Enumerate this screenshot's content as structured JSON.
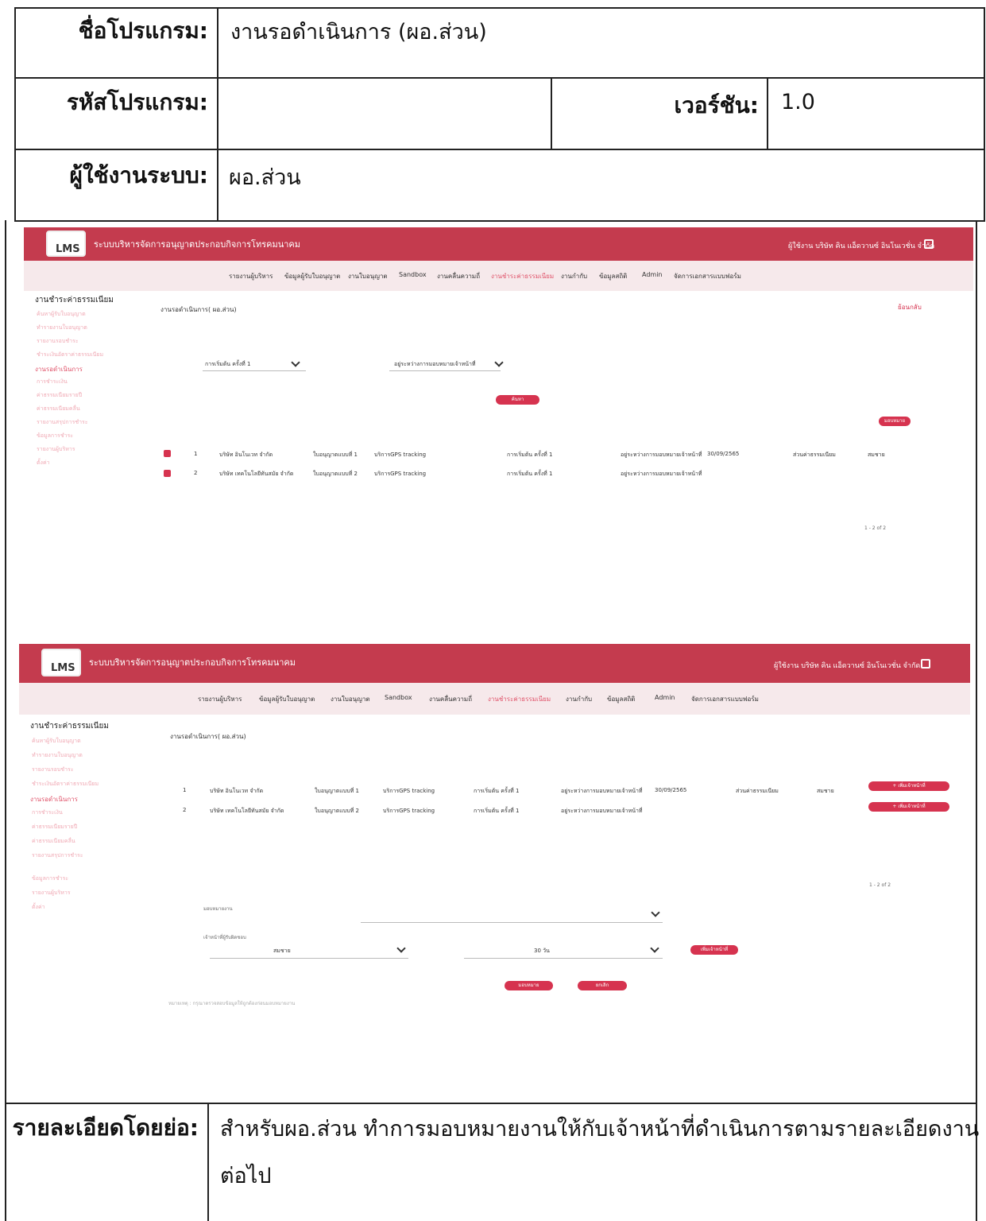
{
  "form": {
    "program_name_label": "ชื่อโปรแกรม:",
    "program_name_value": "งานรอดำเนินการ (ผอ.ส่วน)",
    "program_code_label": "รหัสโปรแกรม:",
    "program_code_value": "",
    "version_label": "เวอร์ชัน:",
    "version_value": "1.0",
    "user_label": "ผู้ใช้งานระบบ:",
    "user_value": "ผอ.ส่วน",
    "summary_label": "รายละเอียดโดยย่อ:",
    "summary_line1": "สำหรับผอ.ส่วน ทำการมอบหมายงานให้กับเจ้าหน้าที่ดำเนินการตามรายละเอียดงาน",
    "summary_line2": "ต่อไป"
  },
  "screens": {
    "logo_text": "LMS",
    "app_title": "ระบบบริหารจัดการอนุญาตประกอบกิจการโทรคมนาคม",
    "user_info": "ผู้ใช้งาน บริษัท คิน แอ็ดวานซ์ อินโนเวชั่น จำกัด",
    "nav": [
      "รายงานผู้บริหาร",
      "ข้อมูลผู้รับใบอนุญาต",
      "งานใบอนุญาต",
      "Sandbox",
      "งานคลื่นความถี่",
      "งานชำระค่าธรรมเนียม",
      "งานกำกับ",
      "ข้อมูลสถิติ",
      "Admin",
      "จัดการเอกสารแบบฟอร์ม"
    ],
    "sidebar_heading": "งานชำระค่าธรรมเนียม",
    "sidebar_items": [
      "ค้นหาผู้รับใบอนุญาต",
      "ทำรายงานใบอนุญาต",
      "รายงานรอบชำระ",
      "ชำระเงินอัตราค่าธรรมเนียม",
      "งานรอดำเนินการ",
      "การชำระเงิน",
      "ค่าธรรมเนียมรายปี",
      "ค่าธรรมเนียมคลื่น",
      "รายงานสรุปการชำระ",
      "ข้อมูลการชำระ",
      "รายงานผู้บริหาร",
      "ตั้งค่า"
    ],
    "page_title_1": "งานรอดำเนินการ( ผอ.ส่วน)",
    "page_title_2": "งานรอดำเนินการ( ผอ.ส่วน)",
    "back_label": "ย้อนกลับ",
    "filter_select_1": "การเริ่มต้น ครั้งที่ 1",
    "filter_select_2": "อยู่ระหว่างการมอบหมายเจ้าหน้าที่",
    "search_button": "ค้นหา",
    "assign_button": "มอบหมาย",
    "rows": [
      {
        "no": "1",
        "company": "บริษัท อินโนเวท จำกัด",
        "license": "ใบอนุญาตแบบที่ 1",
        "service": "บริการGPS tracking",
        "stage": "การเริ่มต้น ครั้งที่ 1",
        "status": "อยู่ระหว่างการมอบหมายเจ้าหน้าที่",
        "date": "30/09/2565",
        "dept": "ส่วนค่าธรรมเนียม",
        "officer": "สมชาย"
      },
      {
        "no": "2",
        "company": "บริษัท เทคโนโลยีทันสมัย จำกัด",
        "license": "ใบอนุญาตแบบที่ 2",
        "service": "บริการGPS tracking",
        "stage": "การเริ่มต้น ครั้งที่ 1",
        "status": "อยู่ระหว่างการมอบหมายเจ้าหน้าที่",
        "date": "",
        "dept": "",
        "officer": ""
      }
    ],
    "add_officer_label": "+ เพิ่มเจ้าหน้าที่",
    "pagination_1": "1 - 2 of 2",
    "pagination_2": "1 - 2 of 2",
    "assign_section_title": "มอบหมายงาน",
    "officer_section_title": "เจ้าหน้าที่ผู้รับผิดชอบ",
    "officer_name": "สมชาย",
    "days_value": "30 วัน",
    "add_button": "เพิ่มเจ้าหน้าที่",
    "submit_button": "มอบหมาย",
    "cancel_button": "ยกเลิก",
    "note": "หมายเหตุ : กรุณาตรวจสอบข้อมูลให้ถูกต้องก่อนมอบหมายงาน"
  },
  "colors": {
    "brand": "#c43b4e",
    "accent": "#d6334f",
    "nav_bg": "#f6e9eb"
  }
}
